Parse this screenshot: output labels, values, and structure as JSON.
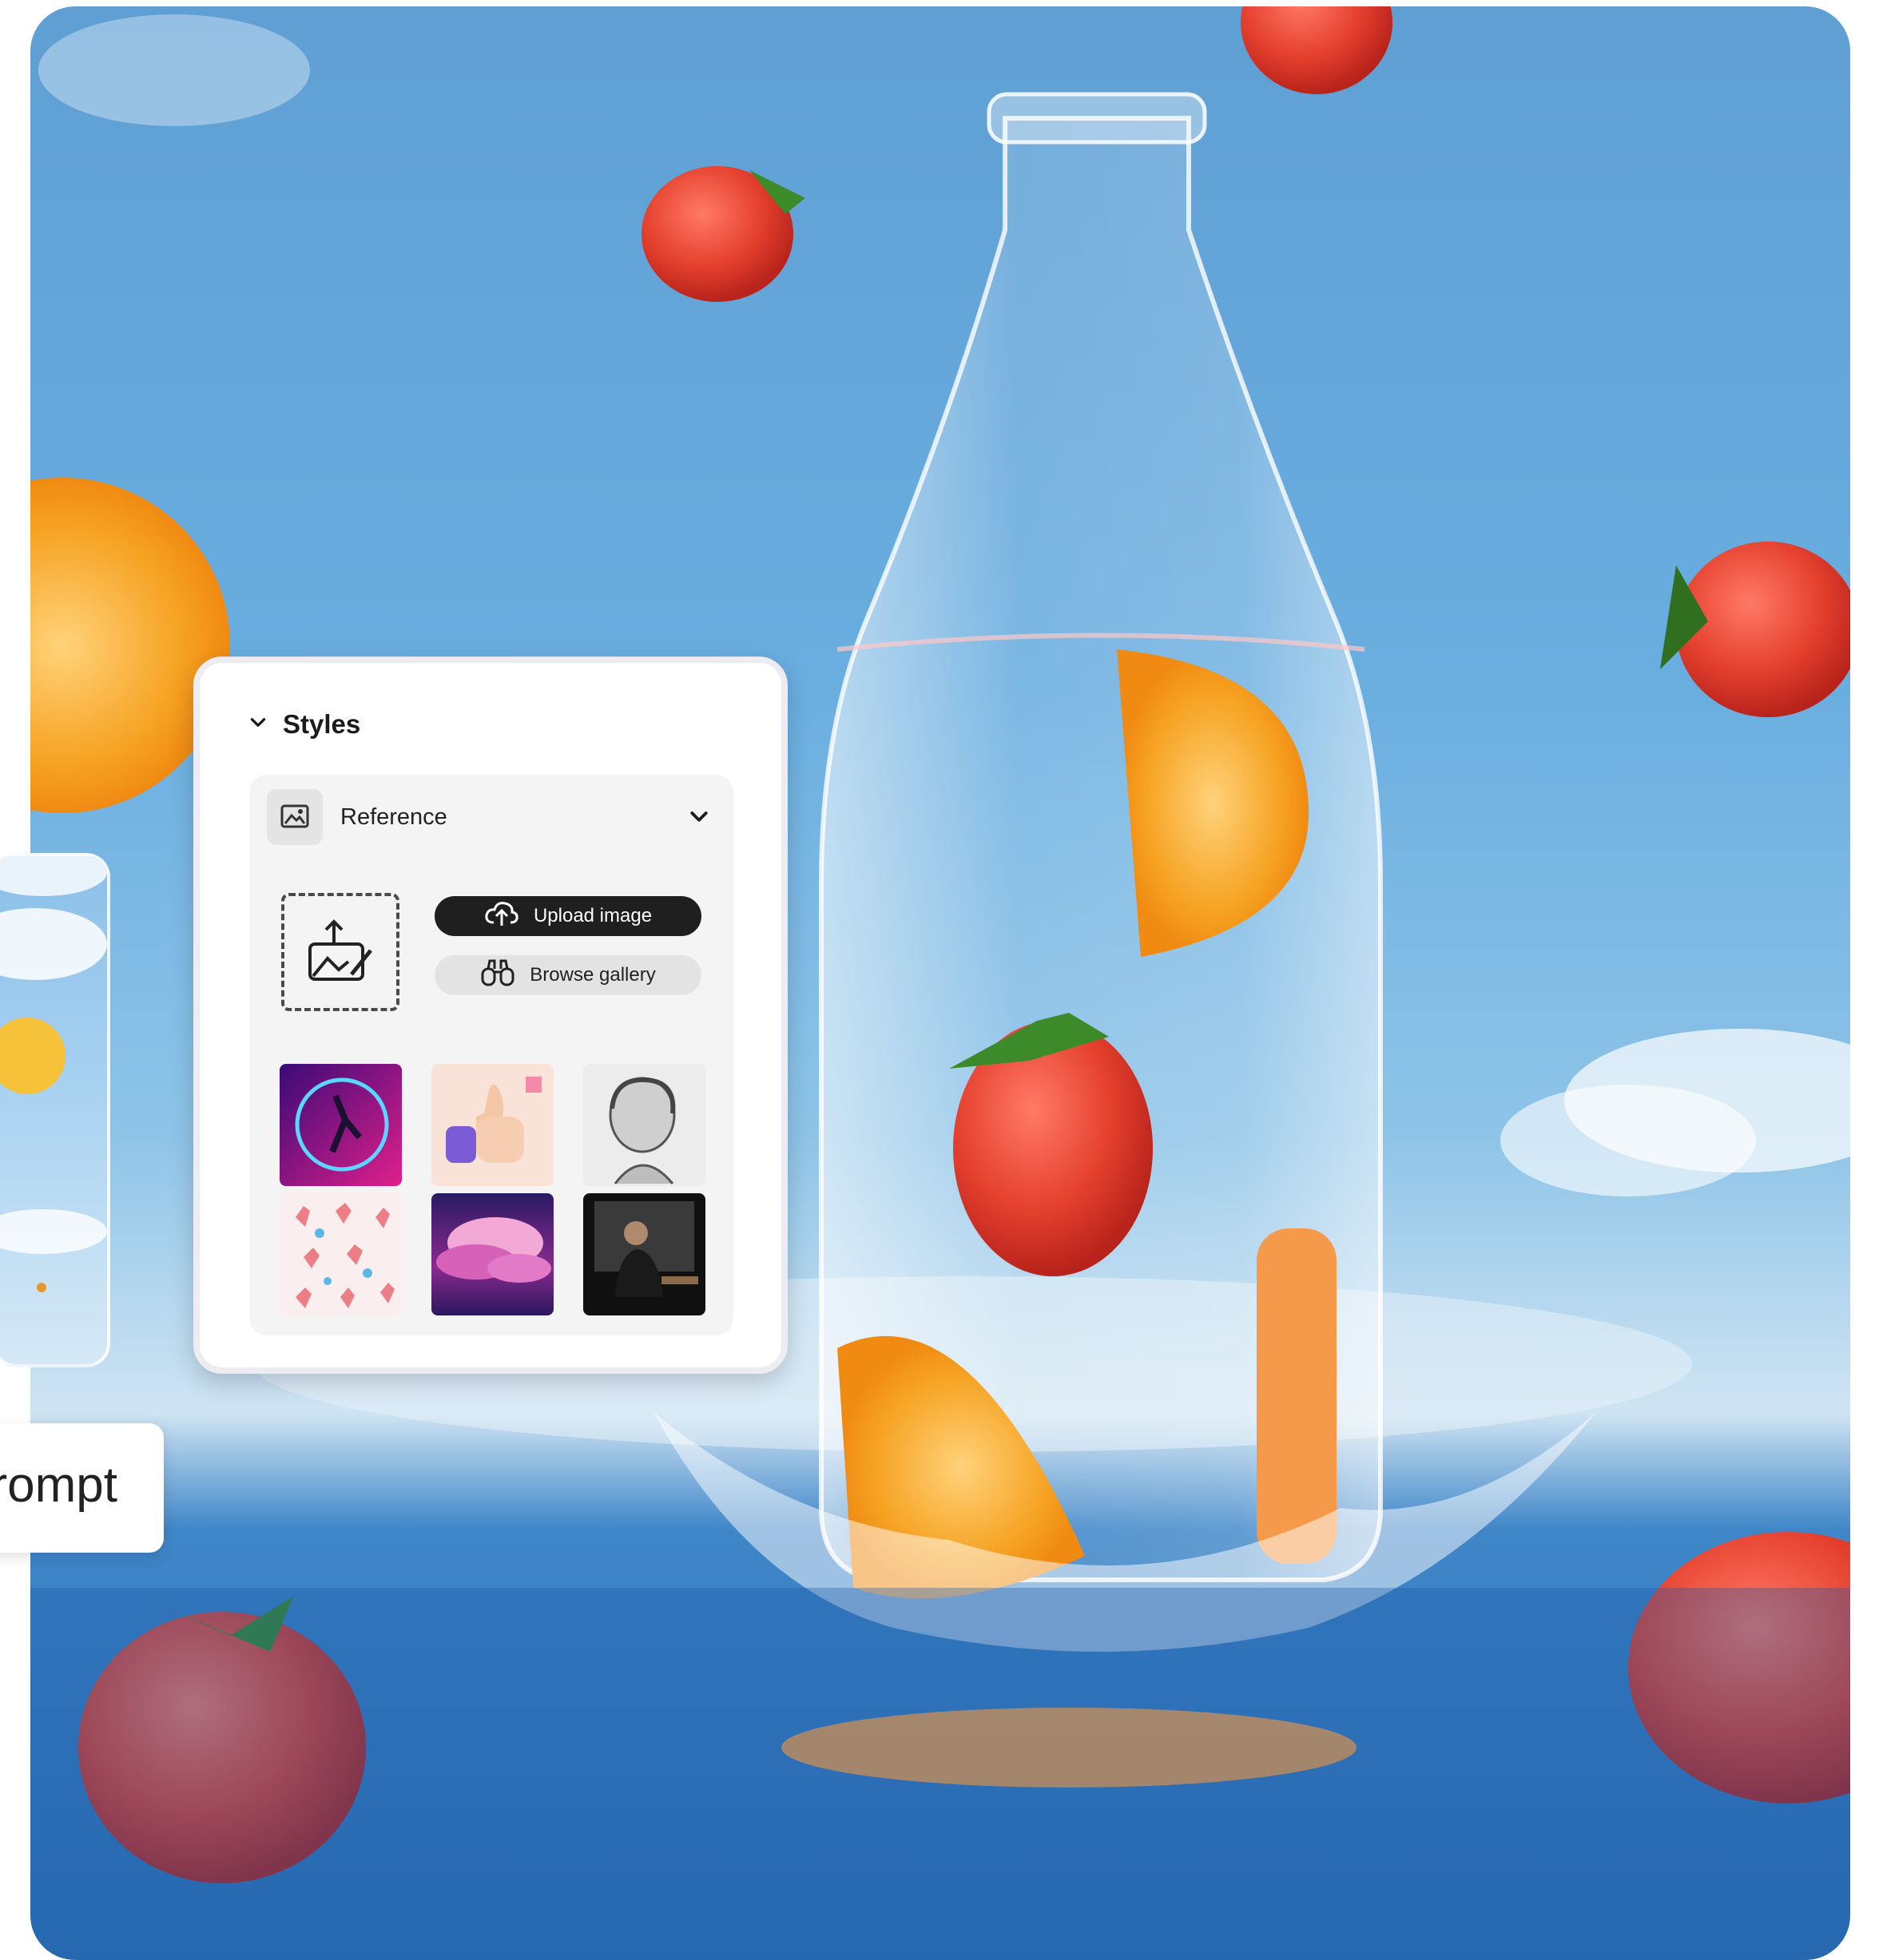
{
  "panel": {
    "title": "Styles",
    "reference_label": "Reference",
    "upload_label": "Upload image",
    "browse_label": "Browse gallery",
    "thumbnails": [
      "neon-dancer-thumbnail",
      "thumbs-up-3d-thumbnail",
      "engraving-portrait-thumbnail",
      "hands-pattern-thumbnail",
      "pink-clouds-thumbnail",
      "seated-man-photo-thumbnail"
    ]
  },
  "prompt": {
    "label": "rompt"
  },
  "colors": {
    "accent_dark": "#1f1f1f",
    "sky": "#6aaee0",
    "sea": "#2f72b5"
  },
  "icons": [
    "chevron-down-icon",
    "image-reference-icon",
    "upload-image-icon",
    "cloud-upload-icon",
    "binoculars-icon"
  ]
}
